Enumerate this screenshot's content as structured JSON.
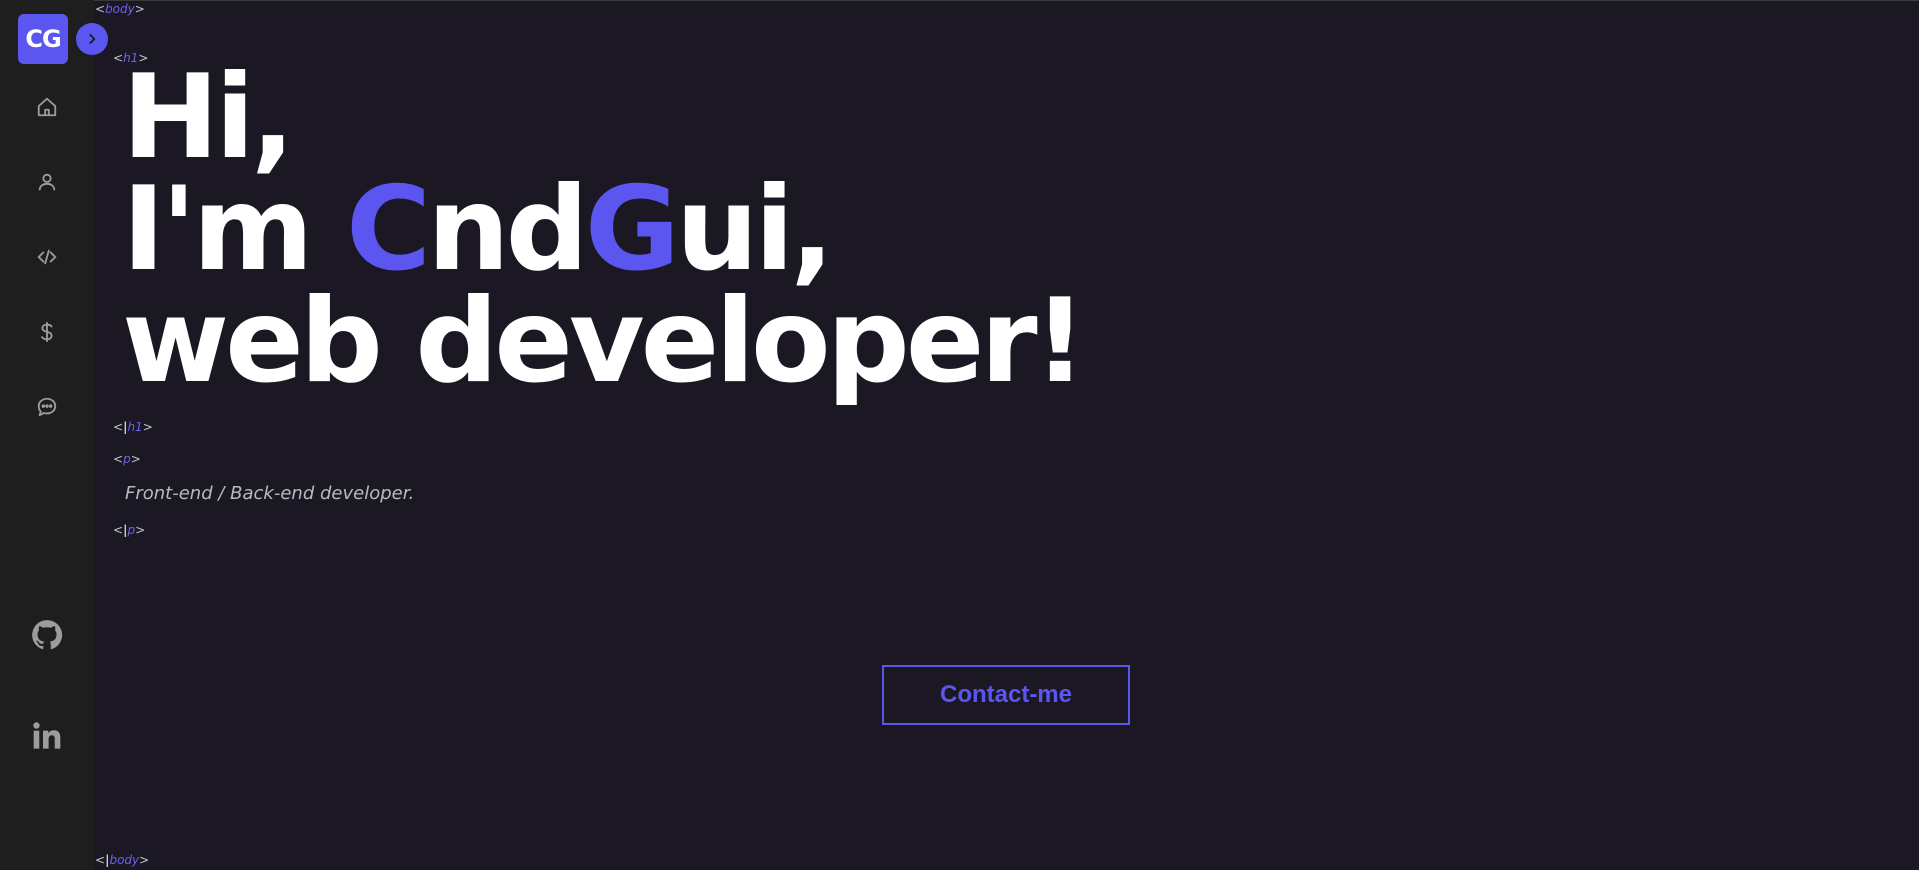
{
  "logo": {
    "text": "CG"
  },
  "tags": {
    "body_open_lt": "<",
    "body_name": "body",
    "body_open_gt": ">",
    "h1_open_lt": "<",
    "h1_name": "h1",
    "h1_open_gt": ">",
    "h1_close_lt": "<",
    "h1_close_slash": "|",
    "h1_close_name": "h1",
    "h1_close_gt": ">",
    "p_open_lt": "<",
    "p_name": "p",
    "p_open_gt": ">",
    "p_close_lt": "<",
    "p_close_slash": "|",
    "p_close_name": "p",
    "p_close_gt": ">",
    "body_close_lt": "<",
    "body_close_slash": "|",
    "body_close_name": "body",
    "body_close_gt": ">"
  },
  "hero": {
    "line1": "Hi,",
    "line2_prefix": "I'm ",
    "line2_c": "C",
    "line2_nd": "nd",
    "line2_g": "G",
    "line2_suffix": "ui,",
    "line3": "web developer!"
  },
  "subtitle": "Front-end / Back-end developer.",
  "contact_button": {
    "label": "Contact-me"
  },
  "sidebar": {
    "nav_icons": [
      "home-icon",
      "user-icon",
      "code-icon",
      "dollar-icon",
      "chat-icon"
    ],
    "social_icons": [
      "github-icon",
      "linkedin-icon"
    ]
  },
  "colors": {
    "background": "#1b1824",
    "sidebar": "#1e1e1e",
    "accent": "#5c56f0",
    "text": "#ffffff",
    "muted": "#b9b9c2"
  }
}
